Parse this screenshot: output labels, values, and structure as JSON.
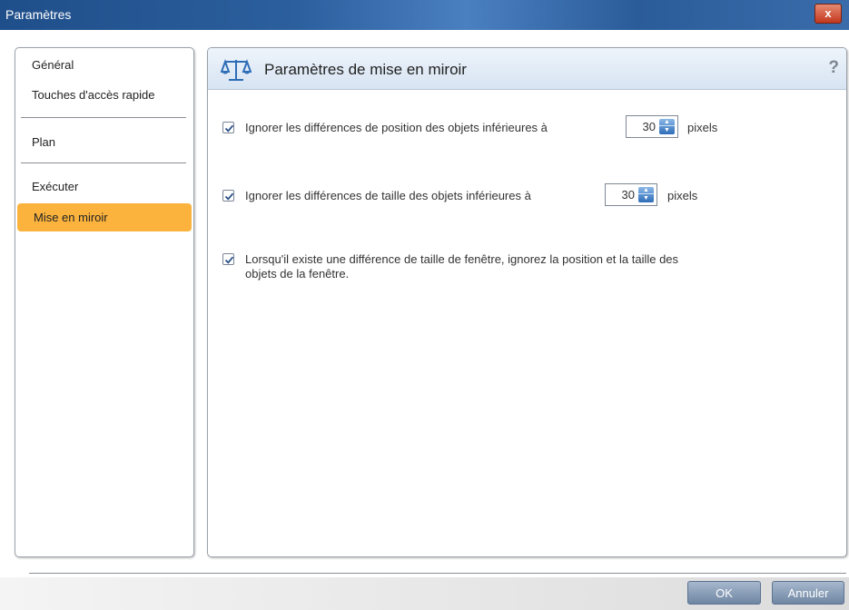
{
  "window": {
    "title": "Paramètres",
    "close_label": "x"
  },
  "sidebar": {
    "items": [
      {
        "label": "Général"
      },
      {
        "label": "Touches d'accès rapide"
      },
      {
        "label": "Plan"
      },
      {
        "label": "Exécuter"
      },
      {
        "label": "Mise en miroir",
        "active": true
      }
    ]
  },
  "panel": {
    "title": "Paramètres de mise en miroir",
    "help_label": "?",
    "icon": "scales-icon",
    "options": [
      {
        "checked": true,
        "label": "Ignorer les différences de position des objets inférieures à",
        "value": "30",
        "unit": "pixels"
      },
      {
        "checked": true,
        "label": "Ignorer les différences de taille des objets inférieures à",
        "value": "30",
        "unit": "pixels"
      },
      {
        "checked": true,
        "line1": "Lorsqu'il existe une différence de taille de fenêtre, ignorez la position et la taille des",
        "line2": "objets de la fenêtre."
      }
    ]
  },
  "footer": {
    "ok_label": "OK",
    "cancel_label": "Annuler"
  },
  "colors": {
    "accent": "#fbb33d",
    "title_bar": "#2c5f9e",
    "close": "#c2381d"
  }
}
